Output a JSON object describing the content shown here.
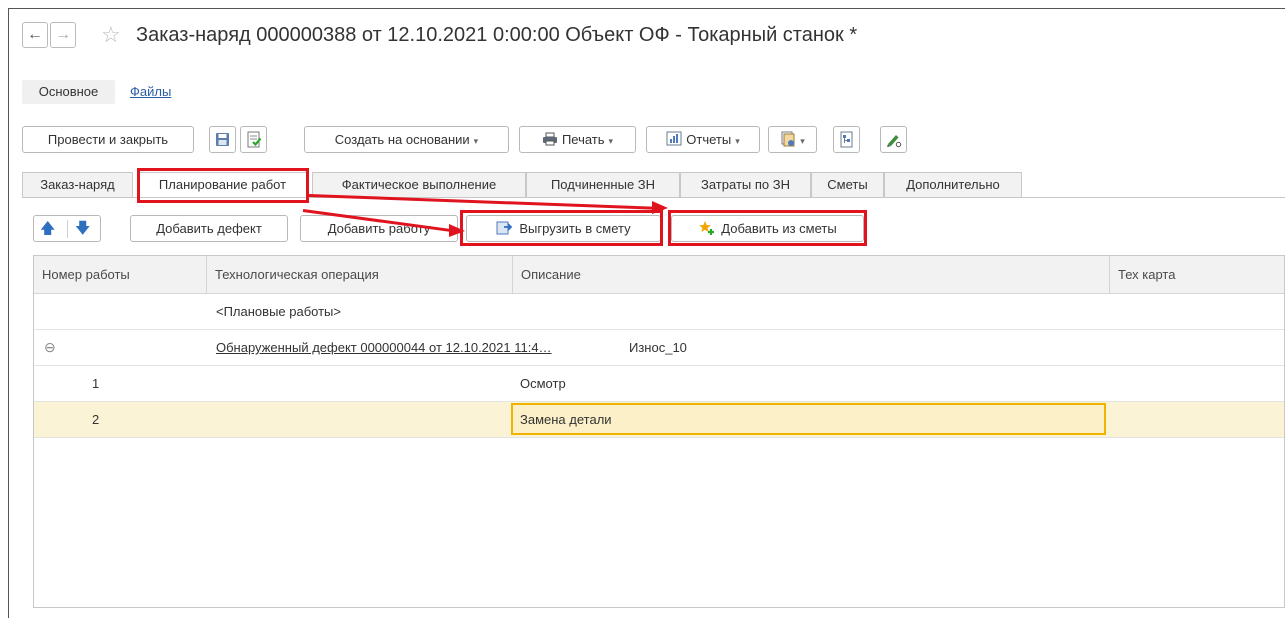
{
  "window": {
    "title": "Заказ-наряд 000000388 от 12.10.2021 0:00:00 Объект ОФ - Токарный станок *",
    "back_glyph": "←",
    "forward_glyph": "→",
    "star_glyph": "☆"
  },
  "sections": {
    "main": "Основное",
    "files": "Файлы"
  },
  "toolbar": {
    "post_close": "Провести и закрыть",
    "create_based": "Создать на основании",
    "print": "Печать",
    "reports": "Отчеты",
    "caret": "▾"
  },
  "tabs": [
    {
      "label": "Заказ-наряд"
    },
    {
      "label": "Планирование работ"
    },
    {
      "label": "Фактическое выполнение"
    },
    {
      "label": "Подчиненные ЗН"
    },
    {
      "label": "Затраты по ЗН"
    },
    {
      "label": "Сметы"
    },
    {
      "label": "Дополнительно"
    }
  ],
  "subtoolbar": {
    "up_glyph": "🡅",
    "down_glyph": "🡇",
    "add_defect": "Добавить дефект",
    "add_work": "Добавить работу",
    "export_estimate": "Выгрузить в смету",
    "add_from_estimate": "Добавить из сметы"
  },
  "table": {
    "columns": [
      "Номер работы",
      "Технологическая операция",
      "Описание",
      "Тех карта"
    ],
    "rows": [
      {
        "num": "",
        "operation": "<Плановые работы>",
        "description": ""
      },
      {
        "num": "⊖",
        "operation": "Обнаруженный дефект 000000044 от 12.10.2021 11:4…",
        "description": "Износ_10"
      },
      {
        "num": "1",
        "operation": "",
        "description": "Осмотр"
      },
      {
        "num": "2",
        "operation": "",
        "description": "Замена детали"
      }
    ]
  },
  "colors": {
    "highlight_red": "#e0141e",
    "selected_row": "#fbf3d5",
    "active_cell_border": "#f0b400",
    "link": "#2a5ea8"
  }
}
